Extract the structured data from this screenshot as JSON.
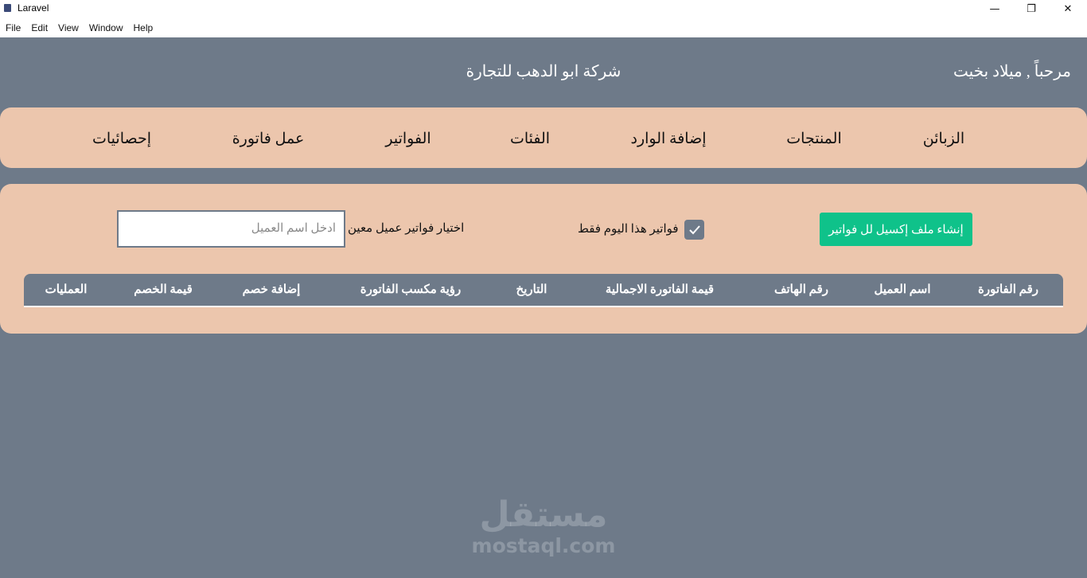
{
  "window": {
    "title": "Laravel",
    "minimize": "—",
    "restore": "❐",
    "close": "✕"
  },
  "menu": [
    "File",
    "Edit",
    "View",
    "Window",
    "Help"
  ],
  "header": {
    "welcome": "مرحباً , ميلاد بخيت",
    "company": "شركة ابو الدهب للتجارة"
  },
  "nav": {
    "customers": "الزبائن",
    "products": "المنتجات",
    "add_incoming": "إضافة الوارد",
    "categories": "الفئات",
    "invoices": "الفواتير",
    "make_invoice": "عمل فاتورة",
    "statistics": "إحصائيات"
  },
  "filters": {
    "excel_button": "إنشاء ملف إكسيل لل فواتير",
    "today_only_label": "فواتير هذا اليوم فقط",
    "today_only_checked": true,
    "select_client_label": "اختيار فواتير عميل معين",
    "client_input_placeholder": "ادخل اسم العميل"
  },
  "table": {
    "columns": {
      "invoice_number": "رقم الفاتورة",
      "client_name": "اسم العميل",
      "phone": "رقم الهاتف",
      "total": "قيمة الفاتورة الاجمالية",
      "date": "التاريخ",
      "profit": "رؤية مكسب الفاتورة",
      "add_discount": "إضافة خصم",
      "discount_value": "قيمة الخصم",
      "operations": "العمليات"
    }
  },
  "watermark": {
    "arabic": "مستقل",
    "latin": "mostaql.com"
  },
  "colors": {
    "background": "#6e7a89",
    "panel": "#ecc6ad",
    "accent_green": "#0fc28a"
  }
}
